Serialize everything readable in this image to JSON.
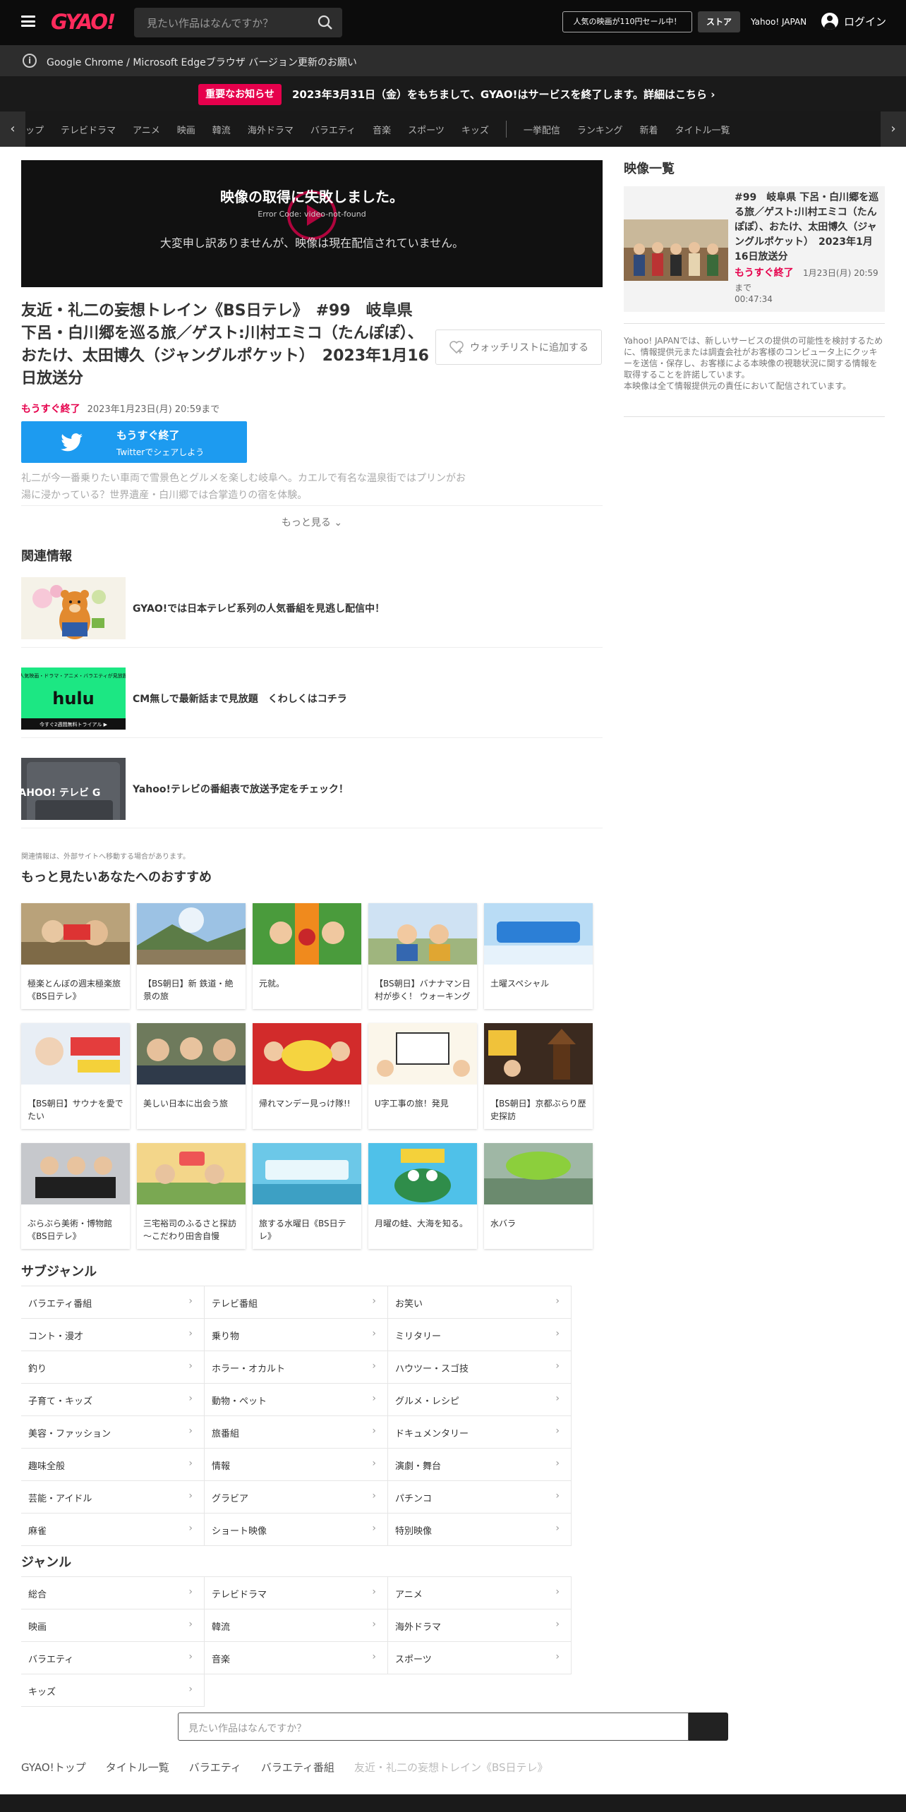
{
  "header": {
    "logo": "GYAO!",
    "search_placeholder": "見たい作品はなんですか？",
    "promo_label": "人気の映画が110円セール中！",
    "store_label": "ストア",
    "yahoo_label": "Yahoo! JAPAN",
    "login_label": "ログイン"
  },
  "notice": {
    "text": "Google Chrome / Microsoft Edgeブラウザ バージョン更新のお願い"
  },
  "alert": {
    "badge": "重要なお知らせ",
    "message": "2023年3月31日（金）をもちまして、GYAO!はサービスを終了します。詳細はこちら ›"
  },
  "nav": {
    "items_left": [
      "ップ",
      "テレビドラマ",
      "アニメ",
      "映画",
      "韓流",
      "海外ドラマ",
      "バラエティ",
      "音楽",
      "スポーツ",
      "キッズ"
    ],
    "items_right": [
      "一挙配信",
      "ランキング",
      "新着",
      "タイトル一覧"
    ]
  },
  "player": {
    "error_title": "映像の取得に失敗しました。",
    "error_code": "Error Code: video-not-found",
    "error_message": "大変申し訳ありませんが、映像は現在配信されていません。"
  },
  "episode": {
    "title": "友近・礼二の妄想トレイン《BS日テレ》　#99　岐阜県 下呂・白川郷を巡る旅／ゲスト:川村エミコ（たんぽぽ）、おたけ、太田博久（ジャングルポケット）　2023年1月16日放送分",
    "ending_label": "もうすぐ終了",
    "until": "2023年1月23日(月) 20:59まで",
    "watchlist_label": "ウォッチリストに追加する",
    "twitter_line1": "もうすぐ終了",
    "twitter_line2": "Twitterでシェアしよう",
    "description": "礼二が今一番乗りたい車両で雪景色とグルメを楽しむ岐阜へ。カエルで有名な温泉街ではプリンがお湯に浸かっている？世界遺産・白川郷では合掌造りの宿を体験。",
    "more_label": "もっと見る ⌄"
  },
  "related": {
    "title": "関連情報",
    "items": [
      {
        "text": "GYAO!では日本テレビ系列の人気番組を見逃し配信中！"
      },
      {
        "text": "CM無しで最新話まで見放題　くわしくはコチラ"
      },
      {
        "text": "Yahoo!テレビの番組表で放送予定をチェック！"
      }
    ],
    "note": "関連情報は、外部サイトへ移動する場合があります。",
    "hulu_top": "人気映画・ドラマ・アニメ・バラエティが見放題",
    "hulu_logo": "hulu",
    "hulu_bottom": "今すぐ2週間無料トライアル ▶",
    "yahoo_tv_logo": "YAHOO! テレビ G"
  },
  "recommend": {
    "title": "もっと見たいあなたへのおすすめ",
    "items": [
      {
        "label": "極楽とんぼの週末極楽旅《BS日テレ》"
      },
      {
        "label": "【BS朝日】新 鉄道・絶景の旅"
      },
      {
        "label": "元就。"
      },
      {
        "label": "【BS朝日】バナナマン日村が歩く！ ウォーキングのひむ太郎"
      },
      {
        "label": "土曜スペシャル"
      },
      {
        "label": "【BS朝日】サウナを愛でたい"
      },
      {
        "label": "美しい日本に出会う旅"
      },
      {
        "label": "帰れマンデー見っけ隊!!"
      },
      {
        "label": "U字工事の旅！発見"
      },
      {
        "label": "【BS朝日】京都ぶらり歴史探訪"
      },
      {
        "label": "ぶらぶら美術・博物館《BS日テレ》"
      },
      {
        "label": "三宅裕司のふるさと探訪～こだわり田舎自慢"
      },
      {
        "label": "旅する水曜日《BS日テレ》"
      },
      {
        "label": "月曜の蛙、大海を知る。"
      },
      {
        "label": "水バラ"
      }
    ]
  },
  "subgenre": {
    "title": "サブジャンル",
    "items": [
      "バラエティ番組",
      "テレビ番組",
      "お笑い",
      "コント・漫才",
      "乗り物",
      "ミリタリー",
      "釣り",
      "ホラー・オカルト",
      "ハウツー・スゴ技",
      "子育て・キッズ",
      "動物・ペット",
      "グルメ・レシピ",
      "美容・ファッション",
      "旅番組",
      "ドキュメンタリー",
      "趣味全般",
      "情報",
      "演劇・舞台",
      "芸能・アイドル",
      "グラビア",
      "パチンコ",
      "麻雀",
      "ショート映像",
      "特別映像"
    ]
  },
  "genre": {
    "title": "ジャンル",
    "items": [
      "総合",
      "テレビドラマ",
      "アニメ",
      "映画",
      "韓流",
      "海外ドラマ",
      "バラエティ",
      "音楽",
      "スポーツ",
      "キッズ"
    ]
  },
  "sidebar": {
    "title": "映像一覧",
    "card_title": "#99　岐阜県 下呂・白川郷を巡る旅／ゲスト:川村エミコ（たんぽぽ）、おたけ、太田博久（ジャングルポケット）　2023年1月16日放送分",
    "ending_label": "もうすぐ終了",
    "until_1": "1月23日(月) 20:59",
    "until_2": "まで",
    "duration": "00:47:34",
    "info": "Yahoo! JAPANでは、新しいサービスの提供の可能性を検討するために、情報提供元または調査会社がお客様のコンピュータ上にクッキーを送信・保存し、お客様による本映像の視聴状況に関する情報を取得することを許諾しています。\n本映像は全て情報提供元の責任において配信されています。"
  },
  "bottom": {
    "search_placeholder": "見たい作品はなんですか？",
    "breadcrumbs": [
      "GYAO!トップ",
      "タイトル一覧",
      "バラエティ",
      "バラエティ番組"
    ],
    "breadcrumb_current": "友近・礼二の妄想トレイン《BS日テレ》"
  }
}
